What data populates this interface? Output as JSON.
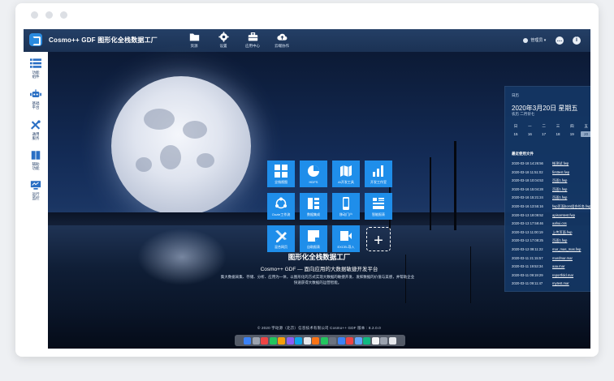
{
  "app": {
    "title": "Cosmo++ GDF  图形化全栈数据工厂"
  },
  "topnav": [
    {
      "label": "资源",
      "icon": "folder-icon"
    },
    {
      "label": "设置",
      "icon": "gear-icon"
    },
    {
      "label": "应用中心",
      "icon": "briefcase-icon"
    },
    {
      "label": "云端协作",
      "icon": "cloud-icon"
    }
  ],
  "user": {
    "name": "管理员 ▾"
  },
  "right_icons": {
    "chat": "…",
    "info": "i"
  },
  "sidebar": [
    {
      "label": "功能\n组件",
      "icon": "list-icon"
    },
    {
      "label": "基础\n平台",
      "icon": "robot-icon"
    },
    {
      "label": "通用\n服务",
      "icon": "tools-icon"
    },
    {
      "label": "辅助\n功能",
      "icon": "book-icon"
    },
    {
      "label": "运行\n监控",
      "icon": "monitor-icon"
    }
  ],
  "tiles": [
    {
      "label": "全栈视图",
      "icon": "grid-icon"
    },
    {
      "label": "HDFS",
      "icon": "pie-icon"
    },
    {
      "label": "AI开发工具",
      "icon": "map-icon"
    },
    {
      "label": "开发工作室",
      "icon": "bar-chart-icon"
    },
    {
      "label": "Oozie工作流",
      "icon": "cycle-icon"
    },
    {
      "label": "数据集成",
      "icon": "stack-icon"
    },
    {
      "label": "移动门户",
      "icon": "phone-icon"
    },
    {
      "label": "智能报表",
      "icon": "report-icon"
    },
    {
      "label": "混合网页",
      "icon": "pencil-ruler-icon"
    },
    {
      "label": "自助报表",
      "icon": "note-icon"
    },
    {
      "label": "EXCEL导入",
      "icon": "excel-icon"
    },
    {
      "label": "+",
      "icon": "plus-icon"
    }
  ],
  "headline": {
    "title": "图形化全栈数据工厂",
    "subtitle": "Cosmo++ GDF — 面向应用的大数据敏捷开发平台",
    "description": "集大数据采集、存储、分析、应用为一体，以图形化的方式实现大数据的敏捷开发、发挥数据的价值与美感，并帮助企业快速获得大数据的运营智能。"
  },
  "calendar": {
    "label": "日历",
    "date": "2020年3月20日 星期五",
    "lunar": "农历 二月廿七",
    "weekdays": [
      "日",
      "一",
      "二",
      "三",
      "四",
      "五",
      "六"
    ],
    "days": [
      "15",
      "16",
      "17",
      "18",
      "19",
      "20",
      "21"
    ],
    "today_index": 5
  },
  "recent": {
    "title": "最近使用文件",
    "files": [
      {
        "date": "2020-03-18 14:26:56",
        "name": "帐测试.fwp"
      },
      {
        "date": "2020-03-18 11:51:02",
        "name": "firsttest.fwp"
      },
      {
        "date": "2020-03-18 10:04:53",
        "name": "页面1.fwp"
      },
      {
        "date": "2020-03-16 15:04:28",
        "name": "页面1.fwp"
      },
      {
        "date": "2020-03-16 15:21:24",
        "name": "页面1.fwp"
      },
      {
        "date": "2020-03-16 13:55:16",
        "name": "fwp页面bom组合任务.fwp"
      },
      {
        "date": "2020-03-13 19:09:52",
        "name": "apisomtest.fwp"
      },
      {
        "date": "2020-03-13 17:59:46",
        "name": "aahui.css"
      },
      {
        "date": "2020-03-13 11:00:19",
        "name": "上传页面.fwp"
      },
      {
        "date": "2020-03-12 17:08:25",
        "name": "页面1.fwp"
      },
      {
        "date": "2020-03-12 09:11:22",
        "name": "mar_mas_mas.fwp"
      },
      {
        "date": "2020-03-11 21:15:57",
        "name": "mardmar.mar"
      },
      {
        "date": "2020-03-11 19:53:34",
        "name": "aaa.mar"
      },
      {
        "date": "2020-03-11 09:19:29",
        "name": "reportfold.mar"
      },
      {
        "date": "2020-03-11 09:11:47",
        "name": "mytest.mar"
      }
    ]
  },
  "footer": {
    "text": "© 2020 宇动源（北京）信息技术有限公司 Cosmo++ GDF 版本 : 8.2.0.0"
  },
  "dock": {
    "colors": [
      "#3b82f6",
      "#9ca3af",
      "#ef4444",
      "#22c55e",
      "#f59e0b",
      "#8b5cf6",
      "#0ea5e9",
      "#e5e7eb",
      "#f97316",
      "#22c55e",
      "#6b7280",
      "#3b82f6",
      "#ef4444",
      "#60a5fa",
      "#10b981",
      "#f3f4f6",
      "#9ca3af",
      "#e5e7eb"
    ]
  }
}
